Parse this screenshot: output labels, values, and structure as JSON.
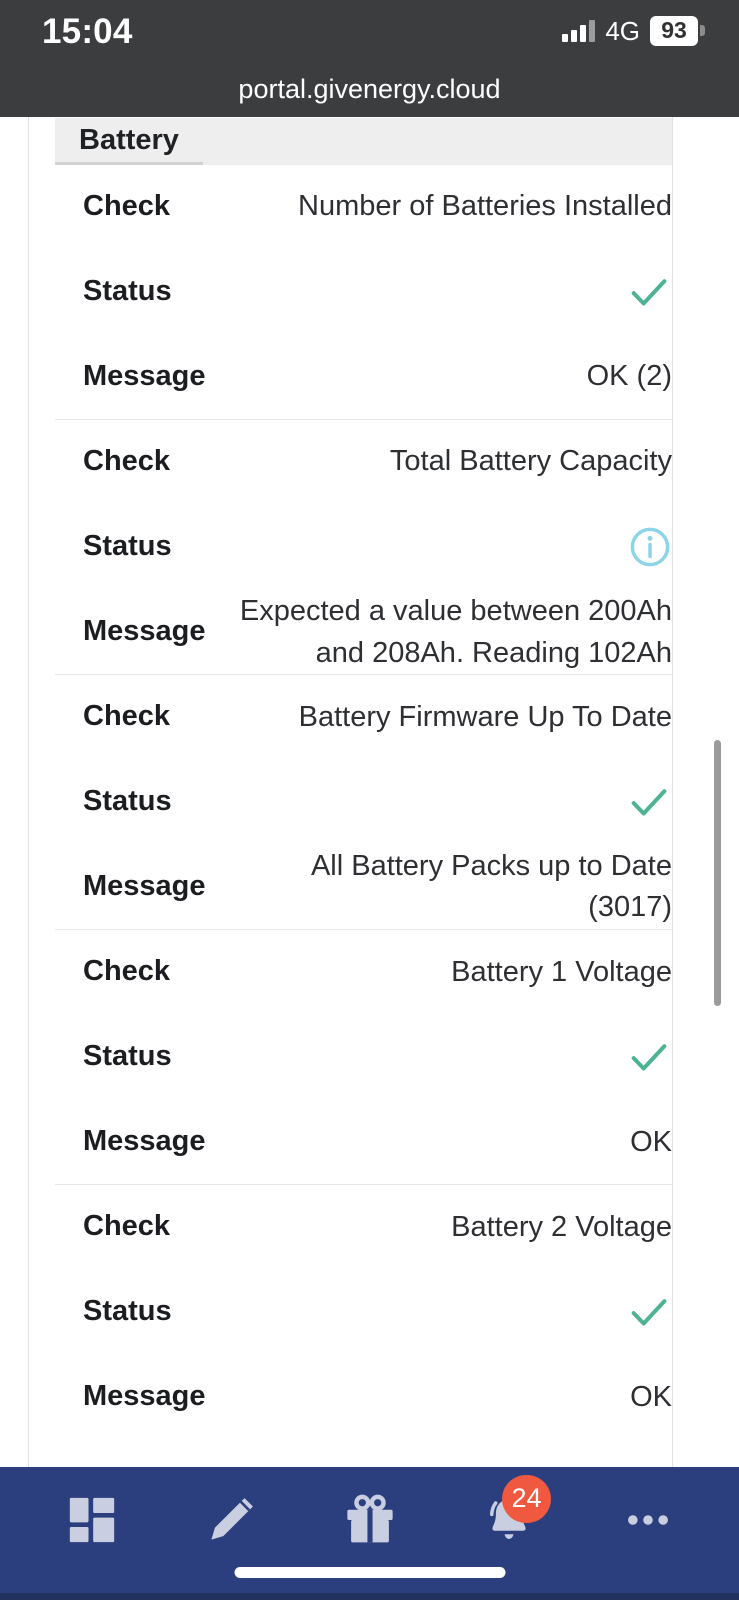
{
  "status_bar": {
    "time": "15:04",
    "network": "4G",
    "battery_percent": "93",
    "signal_icon": "signal-bars-icon",
    "battery_icon": "battery-icon"
  },
  "browser": {
    "url": "portal.givenergy.cloud"
  },
  "tabs": [
    {
      "label": "Battery",
      "active": true
    }
  ],
  "labels": {
    "check": "Check",
    "status": "Status",
    "message": "Message"
  },
  "checks": [
    {
      "check": "Number of Batteries Installed",
      "status_icon": "check-icon",
      "status_type": "ok",
      "message": "OK (2)"
    },
    {
      "check": "Total Battery Capacity",
      "status_icon": "info-icon",
      "status_type": "info",
      "message": "Expected a value between 200Ah and 208Ah. Reading 102Ah"
    },
    {
      "check": "Battery Firmware Up To Date",
      "status_icon": "check-icon",
      "status_type": "ok",
      "message": "All Battery Packs up to Date (3017)"
    },
    {
      "check": "Battery 1 Voltage",
      "status_icon": "check-icon",
      "status_type": "ok",
      "message": "OK"
    },
    {
      "check": "Battery 2 Voltage",
      "status_icon": "check-icon",
      "status_type": "ok",
      "message": "OK"
    }
  ],
  "bottom_nav": {
    "items": [
      {
        "icon": "dashboard-grid-icon",
        "badge": null
      },
      {
        "icon": "pencil-icon",
        "badge": null
      },
      {
        "icon": "gift-icon",
        "badge": null
      },
      {
        "icon": "bell-icon",
        "badge": "24"
      },
      {
        "icon": "ellipsis-icon",
        "badge": null
      }
    ]
  },
  "colors": {
    "ok_green": "#4db391",
    "info_blue": "#8ed4e8",
    "nav_blue": "#2b3f7e",
    "badge_red": "#f0583f",
    "chrome_dark": "#3b3d3f"
  }
}
